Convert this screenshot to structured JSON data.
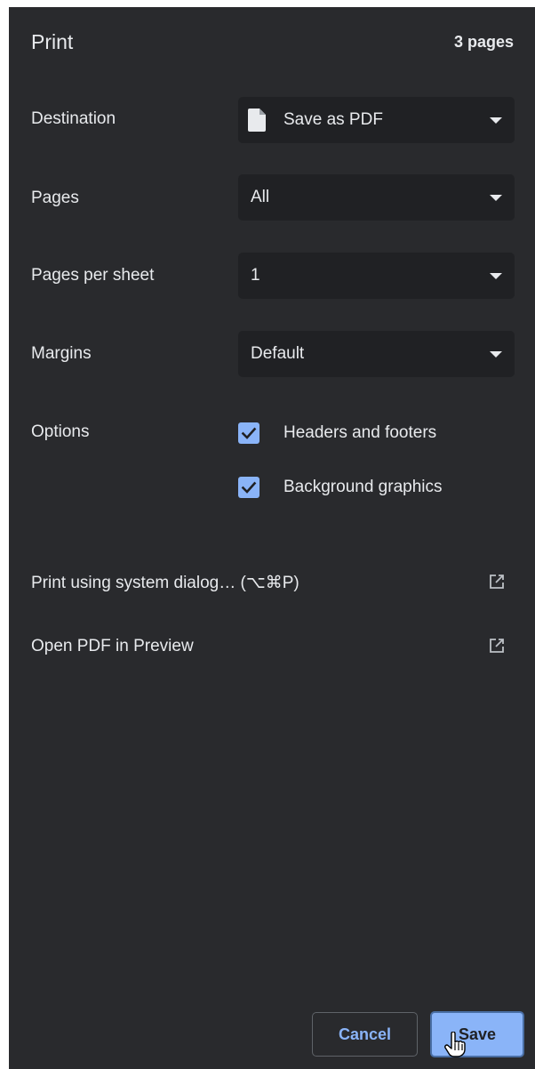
{
  "header": {
    "title": "Print",
    "page_count": "3 pages"
  },
  "settings": {
    "destination": {
      "label": "Destination",
      "value": "Save as PDF",
      "icon": "file-icon"
    },
    "pages": {
      "label": "Pages",
      "value": "All"
    },
    "pages_per_sheet": {
      "label": "Pages per sheet",
      "value": "1"
    },
    "margins": {
      "label": "Margins",
      "value": "Default"
    },
    "options": {
      "label": "Options",
      "items": [
        {
          "label": "Headers and footers",
          "checked": true
        },
        {
          "label": "Background graphics",
          "checked": true
        }
      ]
    }
  },
  "links": [
    {
      "label": "Print using system dialog… (⌥⌘P)",
      "icon": "external-link-icon"
    },
    {
      "label": "Open PDF in Preview",
      "icon": "external-link-icon"
    }
  ],
  "footer": {
    "cancel_label": "Cancel",
    "save_label": "Save"
  },
  "colors": {
    "panel_bg": "#292a2d",
    "control_bg": "#202124",
    "accent": "#8ab4f8",
    "text": "#e8eaed"
  }
}
